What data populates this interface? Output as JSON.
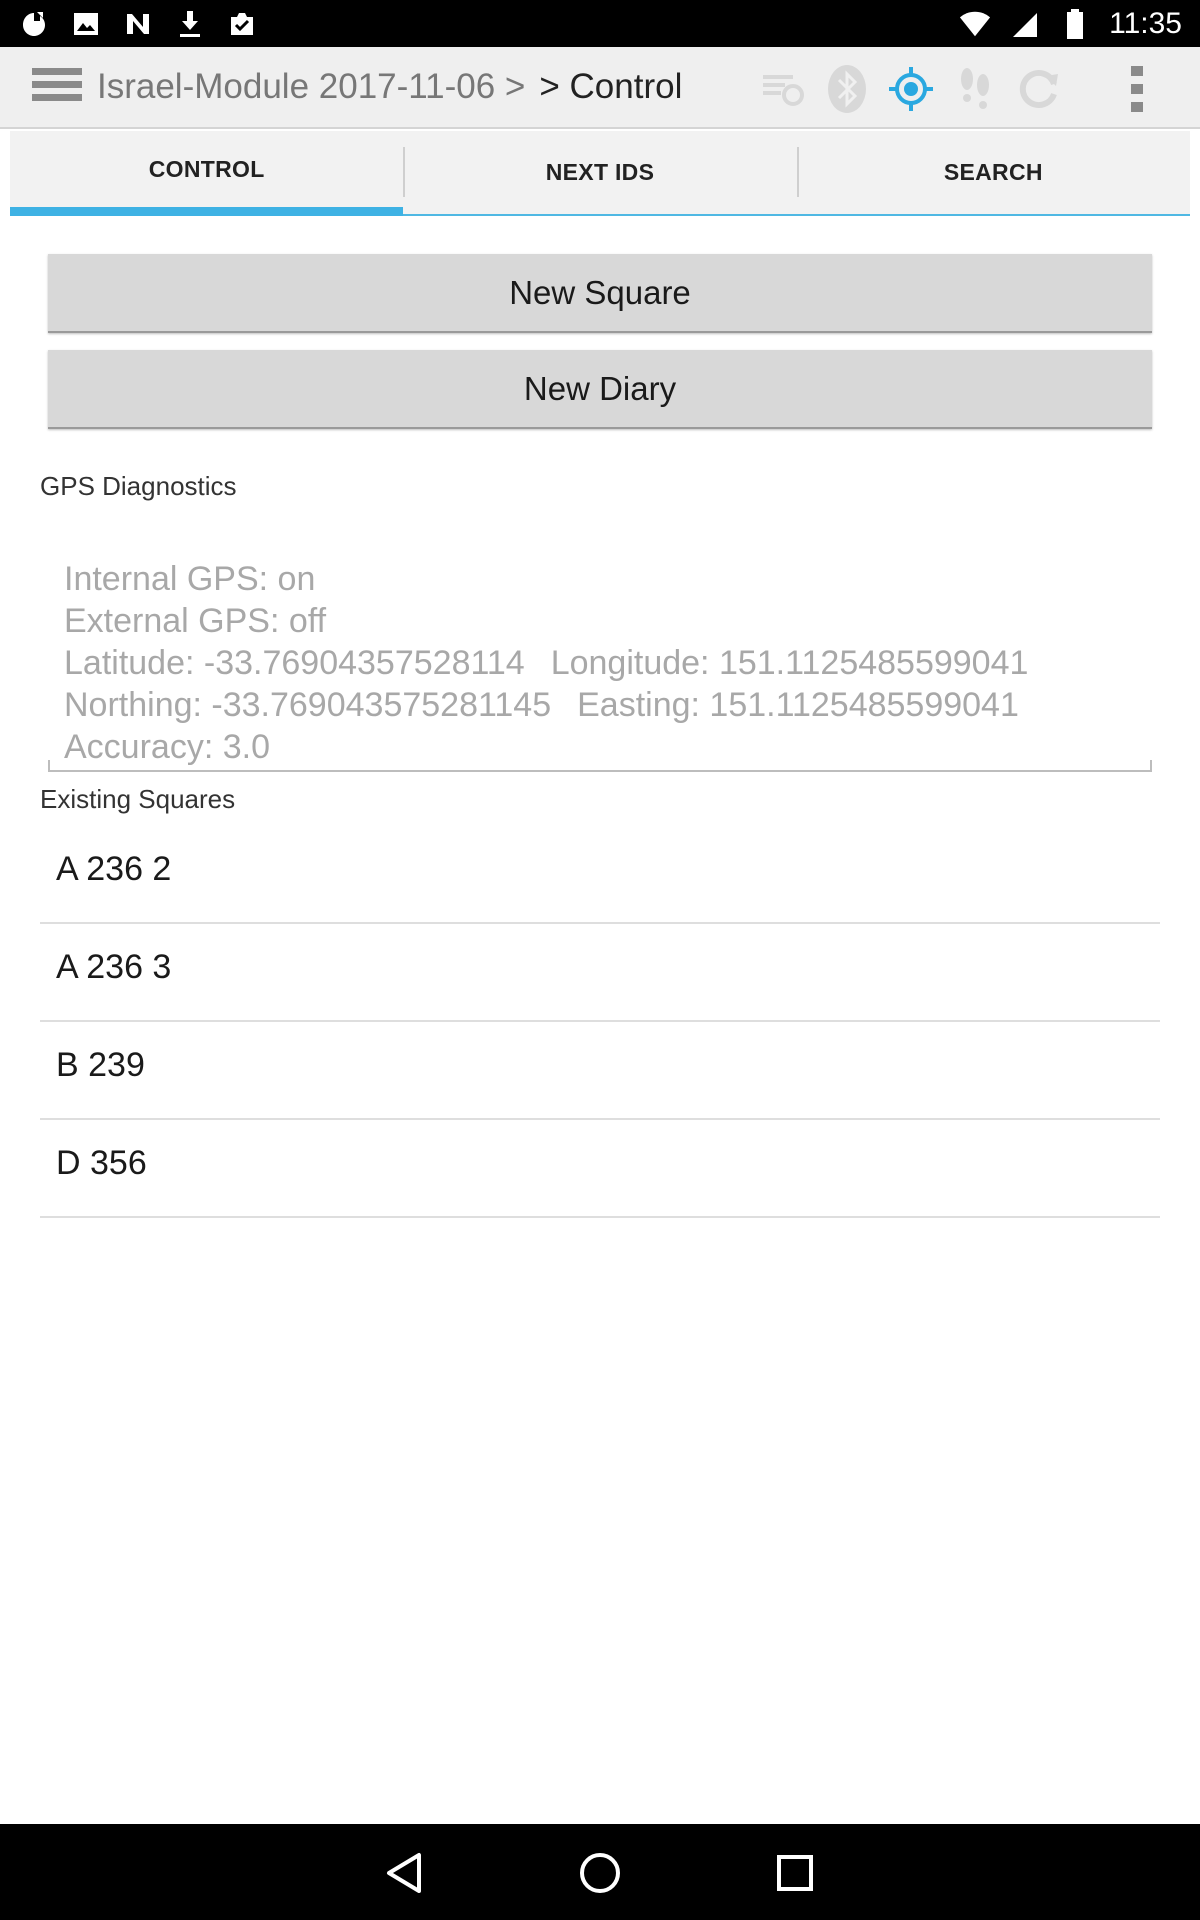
{
  "status_bar": {
    "time": "11:35",
    "left_icons": [
      "app-notification-icon",
      "image-icon",
      "n-app-icon",
      "download-icon",
      "play-store-icon"
    ],
    "right_icons": [
      "wifi-icon",
      "cell-signal-icon",
      "battery-icon"
    ]
  },
  "action_bar": {
    "module": "Israel-Module 2017-11-06 >",
    "current": "> Control",
    "icons": [
      "sync-icon",
      "bluetooth-icon",
      "gps-icon",
      "footprints-icon",
      "refresh-icon",
      "overflow-menu-icon"
    ],
    "active_icon_color": "#2aa8e0"
  },
  "tabs": [
    {
      "label": "CONTROL",
      "active": true
    },
    {
      "label": "NEXT IDS",
      "active": false
    },
    {
      "label": "SEARCH",
      "active": false
    }
  ],
  "buttons": {
    "new_square": "New Square",
    "new_diary": "New Diary"
  },
  "gps": {
    "section_label": "GPS Diagnostics",
    "internal": "Internal GPS: on",
    "external": "External GPS: off",
    "latitude": "Latitude: -33.76904357528114",
    "longitude": "Longitude: 151.1125485599041",
    "northing": "Northing: -33.769043575281145",
    "easting": "Easting: 151.1125485599041",
    "accuracy": "Accuracy: 3.0"
  },
  "squares": {
    "section_label": "Existing Squares",
    "items": [
      "A 236 2",
      "A 236 3",
      "B 239",
      "D 356"
    ]
  },
  "nav_bar": {
    "icons": [
      "back-icon",
      "home-icon",
      "recents-icon"
    ]
  }
}
